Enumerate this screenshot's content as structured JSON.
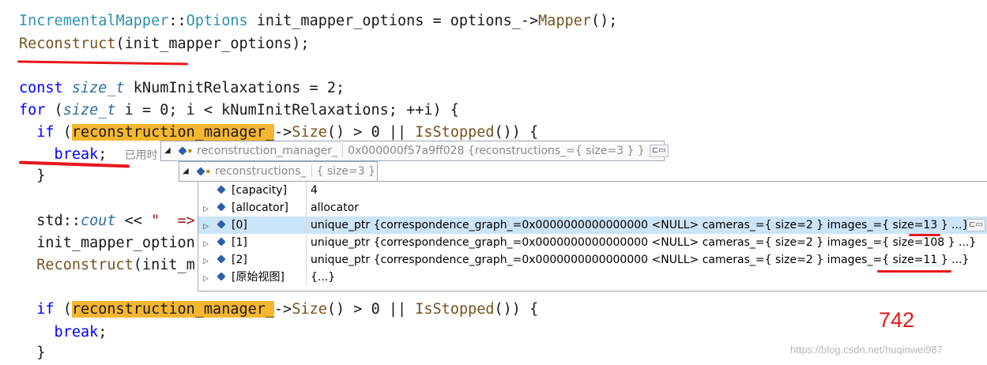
{
  "code": {
    "l1_a": "IncrementalMapper",
    "l1_b": "::",
    "l1_c": "Options",
    "l1_d": " init_mapper_options = options_->",
    "l1_e": "Mapper",
    "l1_f": "();",
    "l2_a": "Reconstruct",
    "l2_b": "(init_mapper_options);",
    "l4_a": "const ",
    "l4_b": "size_t",
    "l4_c": " kNumInitRelaxations = 2;",
    "l5_a": "for",
    "l5_b": " (",
    "l5_c": "size_t",
    "l5_d": " i = 0; i < kNumInitRelaxations; ++i) {",
    "l6_a": "  if",
    "l6_b": " (",
    "l6_c": "reconstruction_manager_",
    "l6_d": "->",
    "l6_e": "Size",
    "l6_f": "() > 0 || ",
    "l6_g": "IsStopped",
    "l6_h": "()) {",
    "l7_a": "    break",
    "l7_b": ";",
    "l7_hint": "已用时",
    "l8": "  }",
    "l10_a": "  std::",
    "l10_b": "cout",
    "l10_c": " << ",
    "l10_d": "\"  =>",
    "l11": "  init_mapper_option",
    "l12_a": "  Reconstruct",
    "l12_b": "(init_m",
    "l14_a": "  if",
    "l14_b": " (",
    "l14_c": "reconstruction_manager_",
    "l14_d": "->",
    "l14_e": "Size",
    "l14_f": "() > 0 || ",
    "l14_g": "IsStopped",
    "l14_h": "()) {",
    "l15_a": "    break",
    "l15_b": ";",
    "l16": "  }"
  },
  "tooltip_outer": {
    "name": "reconstruction_manager_",
    "value": "0x000000f57a9ff028 {reconstructions_={ size=3 } }"
  },
  "tooltip_inner": {
    "name": "reconstructions_",
    "value": "{ size=3 }"
  },
  "rows": [
    {
      "name": "[capacity]",
      "value": "4",
      "expandable": false
    },
    {
      "name": "[allocator]",
      "value": "allocator",
      "expandable": true
    },
    {
      "name": "[0]",
      "value": "unique_ptr {correspondence_graph_=0x0000000000000000 <NULL> cameras_={ size=2 } images_={ size=13 } ...}",
      "expandable": true,
      "selected": true
    },
    {
      "name": "[1]",
      "value": "unique_ptr {correspondence_graph_=0x0000000000000000 <NULL> cameras_={ size=2 } images_={ size=108 } ...}",
      "expandable": true
    },
    {
      "name": "[2]",
      "value": "unique_ptr {correspondence_graph_=0x0000000000000000 <NULL> cameras_={ size=2 } images_={ size=11 } ...}",
      "expandable": true
    },
    {
      "name": "[原始视图]",
      "value": "{...}",
      "expandable": true
    }
  ],
  "annotation": "742",
  "watermark": "https://blog.csdn.net/huqinwei987"
}
